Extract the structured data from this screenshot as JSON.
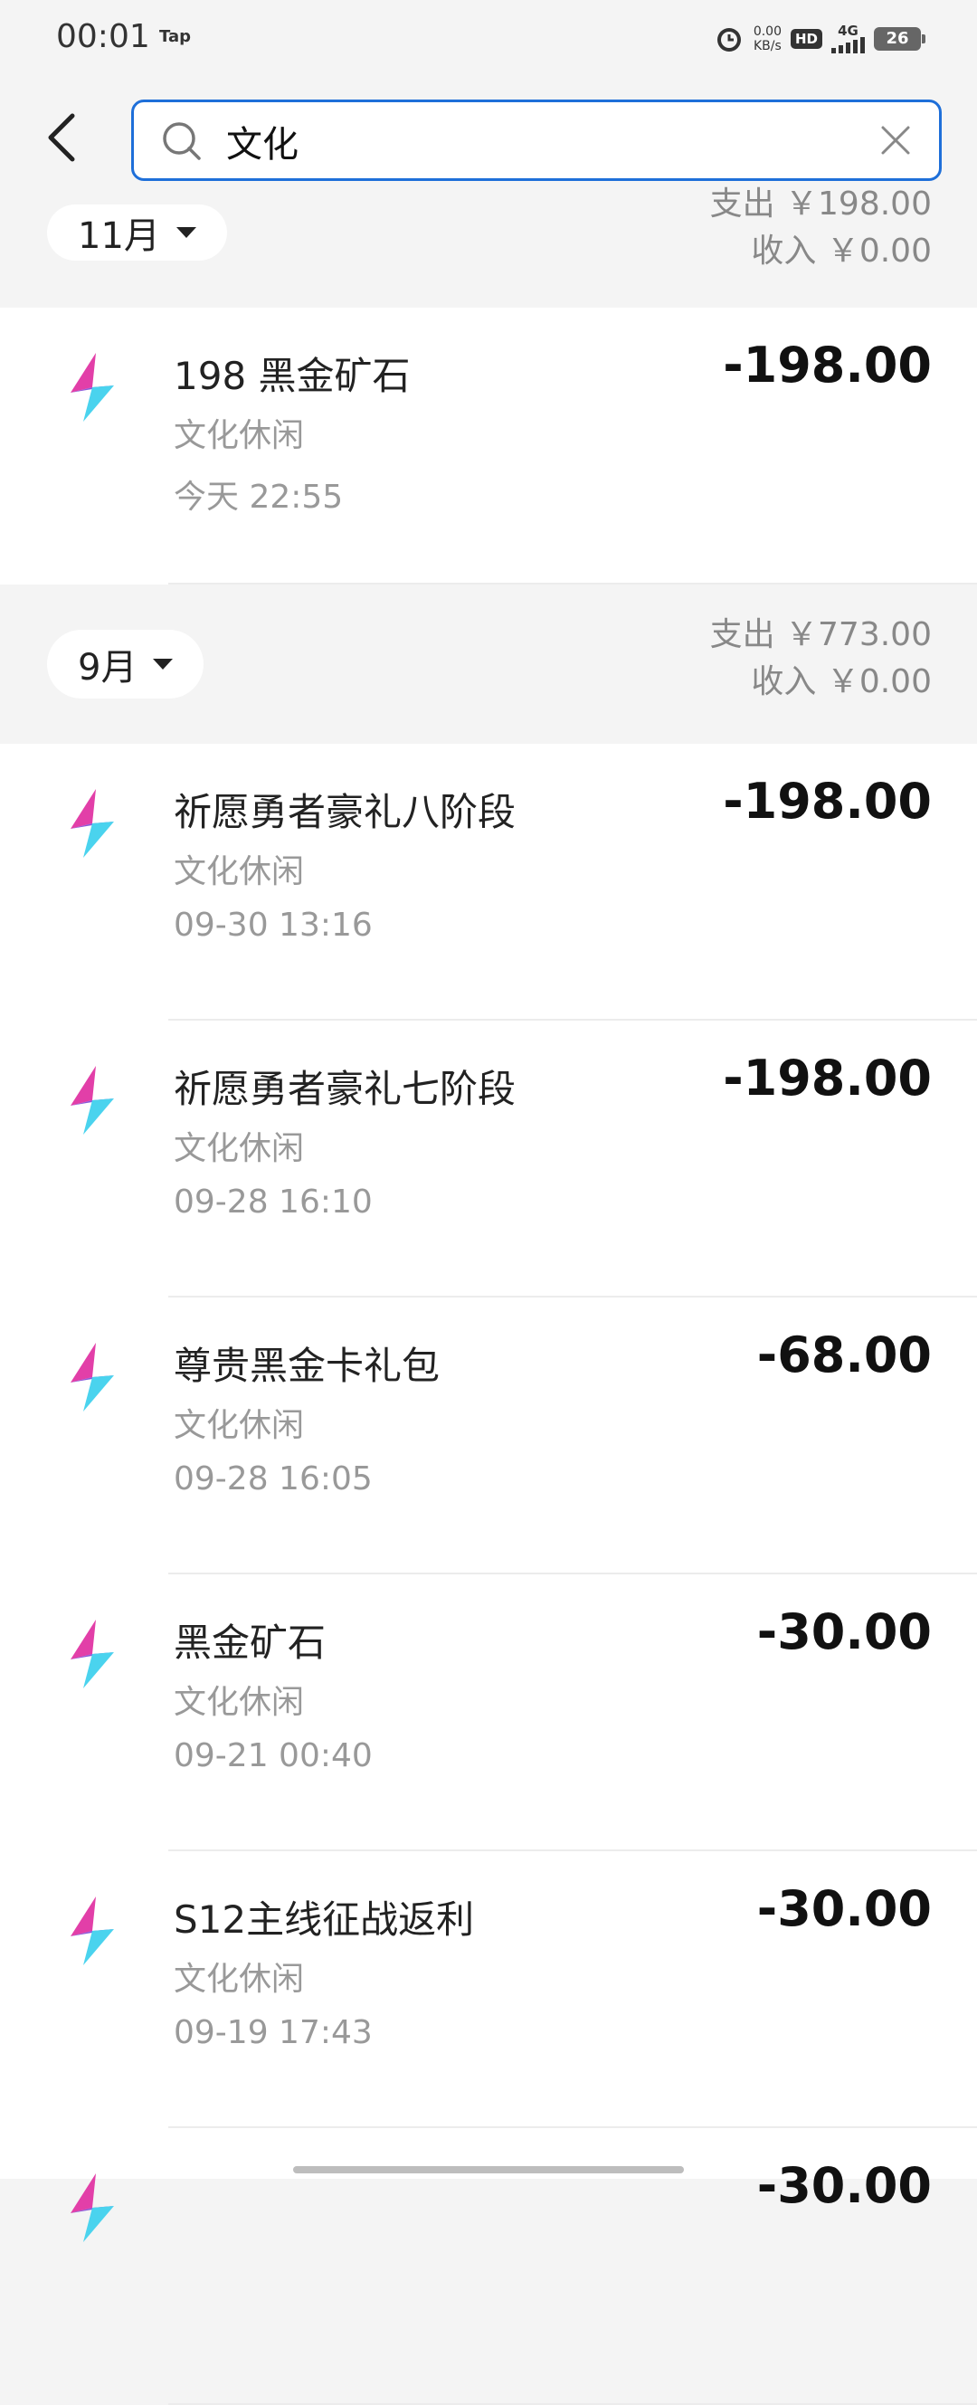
{
  "status_bar": {
    "time": "00:01",
    "tap_label": "Tap",
    "net_speed_value": "0.00",
    "net_speed_unit": "KB/s",
    "hd_label": "HD",
    "network": "4G",
    "battery": "26"
  },
  "search": {
    "value": "文化"
  },
  "months": [
    {
      "label": "11月",
      "expense": "支出 ￥198.00",
      "income": "收入 ￥0.00"
    },
    {
      "label": "9月",
      "expense": "支出 ￥773.00",
      "income": "收入 ￥0.00"
    }
  ],
  "transactions_nov": [
    {
      "title": "198 黑金矿石",
      "category": "文化休闲",
      "time": "今天 22:55",
      "amount": "-198.00"
    }
  ],
  "transactions_sep": [
    {
      "title": "祈愿勇者豪礼八阶段",
      "category": "文化休闲",
      "time": "09-30 13:16",
      "amount": "-198.00"
    },
    {
      "title": "祈愿勇者豪礼七阶段",
      "category": "文化休闲",
      "time": "09-28 16:10",
      "amount": "-198.00"
    },
    {
      "title": "尊贵黑金卡礼包",
      "category": "文化休闲",
      "time": "09-28 16:05",
      "amount": "-68.00"
    },
    {
      "title": "黑金矿石",
      "category": "文化休闲",
      "time": "09-21 00:40",
      "amount": "-30.00"
    },
    {
      "title": "S12主线征战返利",
      "category": "文化休闲",
      "time": "09-19 17:43",
      "amount": "-30.00"
    },
    {
      "title": "",
      "category": "",
      "time": "",
      "amount": "-30.00"
    }
  ]
}
